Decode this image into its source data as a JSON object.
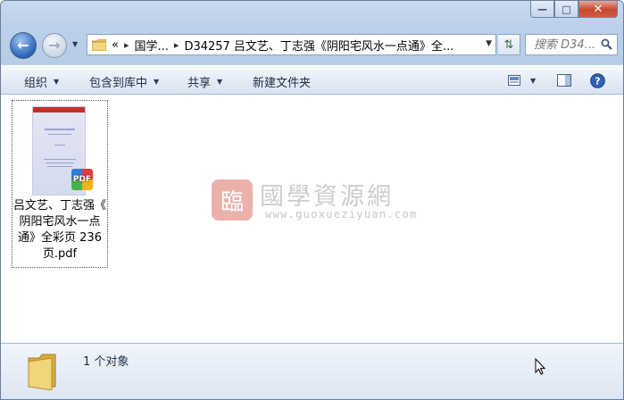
{
  "window": {
    "controls": {
      "minimize": "—",
      "maximize": "□",
      "close": "✕"
    }
  },
  "nav": {
    "back_icon": "back-arrow-icon",
    "forward_icon": "forward-arrow-icon",
    "address": {
      "overflow": "«",
      "crumbs": [
        "国学...",
        "D34257 吕文艺、丁志强《阴阳宅风水一点通》全..."
      ]
    },
    "search_placeholder": "搜索 D34..."
  },
  "toolbar": {
    "organize": "组织",
    "include_in_library": "包含到库中",
    "share": "共享",
    "new_folder": "新建文件夹"
  },
  "file": {
    "name": "吕文艺、丁志强《阴阳宅风水一点通》全彩页 236 页.pdf",
    "name_lines": [
      "吕文艺、丁志强《",
      "阴阳宅风水一点",
      "通》全彩页 236",
      "页.pdf"
    ],
    "badge": "PDF"
  },
  "watermark": {
    "seal_char": "臨",
    "title": "國學資源網",
    "url": "www.guoxueziyuan.com"
  },
  "details": {
    "count": "1 个对象"
  },
  "colors": {
    "accent": "#2a64b8",
    "close": "#c7472f",
    "folder": "#e9c35a"
  }
}
